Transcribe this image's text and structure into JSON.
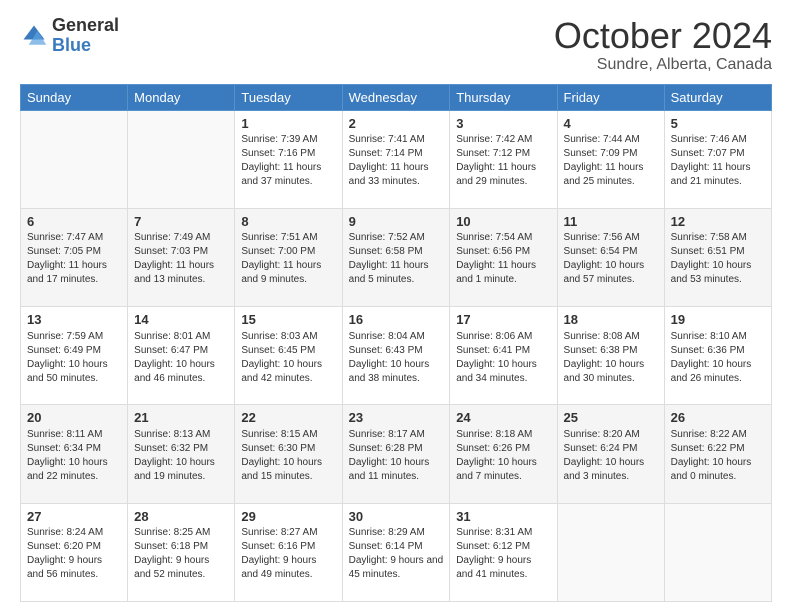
{
  "header": {
    "logo_general": "General",
    "logo_blue": "Blue",
    "month_title": "October 2024",
    "subtitle": "Sundre, Alberta, Canada"
  },
  "days_of_week": [
    "Sunday",
    "Monday",
    "Tuesday",
    "Wednesday",
    "Thursday",
    "Friday",
    "Saturday"
  ],
  "weeks": [
    [
      {
        "day": "",
        "sunrise": "",
        "sunset": "",
        "daylight": ""
      },
      {
        "day": "",
        "sunrise": "",
        "sunset": "",
        "daylight": ""
      },
      {
        "day": "1",
        "sunrise": "Sunrise: 7:39 AM",
        "sunset": "Sunset: 7:16 PM",
        "daylight": "Daylight: 11 hours and 37 minutes."
      },
      {
        "day": "2",
        "sunrise": "Sunrise: 7:41 AM",
        "sunset": "Sunset: 7:14 PM",
        "daylight": "Daylight: 11 hours and 33 minutes."
      },
      {
        "day": "3",
        "sunrise": "Sunrise: 7:42 AM",
        "sunset": "Sunset: 7:12 PM",
        "daylight": "Daylight: 11 hours and 29 minutes."
      },
      {
        "day": "4",
        "sunrise": "Sunrise: 7:44 AM",
        "sunset": "Sunset: 7:09 PM",
        "daylight": "Daylight: 11 hours and 25 minutes."
      },
      {
        "day": "5",
        "sunrise": "Sunrise: 7:46 AM",
        "sunset": "Sunset: 7:07 PM",
        "daylight": "Daylight: 11 hours and 21 minutes."
      }
    ],
    [
      {
        "day": "6",
        "sunrise": "Sunrise: 7:47 AM",
        "sunset": "Sunset: 7:05 PM",
        "daylight": "Daylight: 11 hours and 17 minutes."
      },
      {
        "day": "7",
        "sunrise": "Sunrise: 7:49 AM",
        "sunset": "Sunset: 7:03 PM",
        "daylight": "Daylight: 11 hours and 13 minutes."
      },
      {
        "day": "8",
        "sunrise": "Sunrise: 7:51 AM",
        "sunset": "Sunset: 7:00 PM",
        "daylight": "Daylight: 11 hours and 9 minutes."
      },
      {
        "day": "9",
        "sunrise": "Sunrise: 7:52 AM",
        "sunset": "Sunset: 6:58 PM",
        "daylight": "Daylight: 11 hours and 5 minutes."
      },
      {
        "day": "10",
        "sunrise": "Sunrise: 7:54 AM",
        "sunset": "Sunset: 6:56 PM",
        "daylight": "Daylight: 11 hours and 1 minute."
      },
      {
        "day": "11",
        "sunrise": "Sunrise: 7:56 AM",
        "sunset": "Sunset: 6:54 PM",
        "daylight": "Daylight: 10 hours and 57 minutes."
      },
      {
        "day": "12",
        "sunrise": "Sunrise: 7:58 AM",
        "sunset": "Sunset: 6:51 PM",
        "daylight": "Daylight: 10 hours and 53 minutes."
      }
    ],
    [
      {
        "day": "13",
        "sunrise": "Sunrise: 7:59 AM",
        "sunset": "Sunset: 6:49 PM",
        "daylight": "Daylight: 10 hours and 50 minutes."
      },
      {
        "day": "14",
        "sunrise": "Sunrise: 8:01 AM",
        "sunset": "Sunset: 6:47 PM",
        "daylight": "Daylight: 10 hours and 46 minutes."
      },
      {
        "day": "15",
        "sunrise": "Sunrise: 8:03 AM",
        "sunset": "Sunset: 6:45 PM",
        "daylight": "Daylight: 10 hours and 42 minutes."
      },
      {
        "day": "16",
        "sunrise": "Sunrise: 8:04 AM",
        "sunset": "Sunset: 6:43 PM",
        "daylight": "Daylight: 10 hours and 38 minutes."
      },
      {
        "day": "17",
        "sunrise": "Sunrise: 8:06 AM",
        "sunset": "Sunset: 6:41 PM",
        "daylight": "Daylight: 10 hours and 34 minutes."
      },
      {
        "day": "18",
        "sunrise": "Sunrise: 8:08 AM",
        "sunset": "Sunset: 6:38 PM",
        "daylight": "Daylight: 10 hours and 30 minutes."
      },
      {
        "day": "19",
        "sunrise": "Sunrise: 8:10 AM",
        "sunset": "Sunset: 6:36 PM",
        "daylight": "Daylight: 10 hours and 26 minutes."
      }
    ],
    [
      {
        "day": "20",
        "sunrise": "Sunrise: 8:11 AM",
        "sunset": "Sunset: 6:34 PM",
        "daylight": "Daylight: 10 hours and 22 minutes."
      },
      {
        "day": "21",
        "sunrise": "Sunrise: 8:13 AM",
        "sunset": "Sunset: 6:32 PM",
        "daylight": "Daylight: 10 hours and 19 minutes."
      },
      {
        "day": "22",
        "sunrise": "Sunrise: 8:15 AM",
        "sunset": "Sunset: 6:30 PM",
        "daylight": "Daylight: 10 hours and 15 minutes."
      },
      {
        "day": "23",
        "sunrise": "Sunrise: 8:17 AM",
        "sunset": "Sunset: 6:28 PM",
        "daylight": "Daylight: 10 hours and 11 minutes."
      },
      {
        "day": "24",
        "sunrise": "Sunrise: 8:18 AM",
        "sunset": "Sunset: 6:26 PM",
        "daylight": "Daylight: 10 hours and 7 minutes."
      },
      {
        "day": "25",
        "sunrise": "Sunrise: 8:20 AM",
        "sunset": "Sunset: 6:24 PM",
        "daylight": "Daylight: 10 hours and 3 minutes."
      },
      {
        "day": "26",
        "sunrise": "Sunrise: 8:22 AM",
        "sunset": "Sunset: 6:22 PM",
        "daylight": "Daylight: 10 hours and 0 minutes."
      }
    ],
    [
      {
        "day": "27",
        "sunrise": "Sunrise: 8:24 AM",
        "sunset": "Sunset: 6:20 PM",
        "daylight": "Daylight: 9 hours and 56 minutes."
      },
      {
        "day": "28",
        "sunrise": "Sunrise: 8:25 AM",
        "sunset": "Sunset: 6:18 PM",
        "daylight": "Daylight: 9 hours and 52 minutes."
      },
      {
        "day": "29",
        "sunrise": "Sunrise: 8:27 AM",
        "sunset": "Sunset: 6:16 PM",
        "daylight": "Daylight: 9 hours and 49 minutes."
      },
      {
        "day": "30",
        "sunrise": "Sunrise: 8:29 AM",
        "sunset": "Sunset: 6:14 PM",
        "daylight": "Daylight: 9 hours and 45 minutes."
      },
      {
        "day": "31",
        "sunrise": "Sunrise: 8:31 AM",
        "sunset": "Sunset: 6:12 PM",
        "daylight": "Daylight: 9 hours and 41 minutes."
      },
      {
        "day": "",
        "sunrise": "",
        "sunset": "",
        "daylight": ""
      },
      {
        "day": "",
        "sunrise": "",
        "sunset": "",
        "daylight": ""
      }
    ]
  ]
}
